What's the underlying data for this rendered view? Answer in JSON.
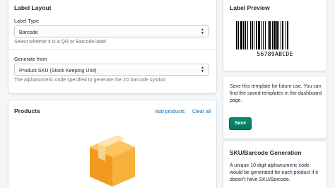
{
  "label_layout": {
    "title": "Label Layout",
    "label_type": {
      "label": "Label Type",
      "value": "Barcode",
      "help": "Select whether it is a QR or Barcode label"
    },
    "generate_from": {
      "label": "Generate from",
      "value": "Product SKU (Stock Keeping Unit)",
      "help": "The alphanumeric code specified to generate the 2D barcode symbol"
    }
  },
  "products": {
    "title": "Products",
    "add_link": "Add products",
    "clear_link": "Clear all",
    "empty_icon": "package-box-icon"
  },
  "label_preview": {
    "title": "Label Preview",
    "barcode_text": "56789ABCDE"
  },
  "save_template": {
    "text": "Save this template for future use. You can find the saved templates in the dashboard page.",
    "button": "Save"
  },
  "sku_generation": {
    "title": "SKU/Barcode Generation",
    "text": "A unique 10 digit alphanumeric code would be generated for each product if it doesn't have SKU/Barcode."
  },
  "colors": {
    "accent": "#007a5c",
    "link": "#006fbb",
    "box_orange": "#f5a623"
  }
}
